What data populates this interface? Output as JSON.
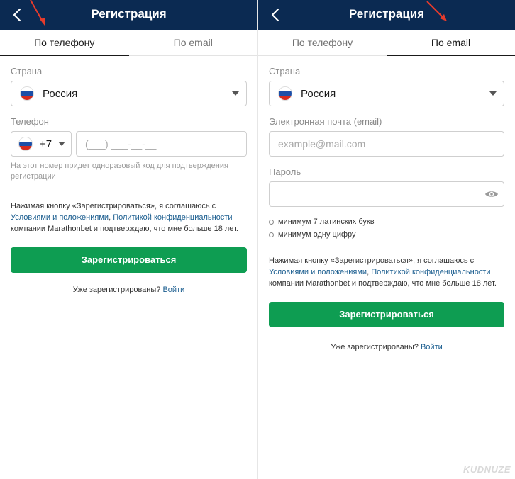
{
  "left": {
    "header": {
      "title": "Регистрация"
    },
    "tabs": [
      {
        "label": "По телефону",
        "active": true
      },
      {
        "label": "По email",
        "active": false
      }
    ],
    "country": {
      "label": "Страна",
      "value": "Россия"
    },
    "phone": {
      "label": "Телефон",
      "code": "+7",
      "placeholder": "(___) ___-__-__",
      "hint": "На этот номер придет одноразовый код для подтверждения регистрации"
    },
    "agreement": {
      "prefix": "Нажимая кнопку «Зарегистрироваться», я соглашаюсь с",
      "link1": "Условиями и положениями",
      "comma": ",",
      "link2": "Политикой конфиденциальности",
      "suffix": "компании Marathonbet и подтверждаю, что мне больше 18 лет."
    },
    "submit_label": "Зарегистрироваться",
    "login": {
      "question": "Уже зарегистрированы?",
      "link": "Войти"
    }
  },
  "right": {
    "header": {
      "title": "Регистрация"
    },
    "tabs": [
      {
        "label": "По телефону",
        "active": false
      },
      {
        "label": "По email",
        "active": true
      }
    ],
    "country": {
      "label": "Страна",
      "value": "Россия"
    },
    "email": {
      "label": "Электронная почта (email)",
      "placeholder": "example@mail.com"
    },
    "password": {
      "label": "Пароль",
      "rules": [
        "минимум 7 латинских букв",
        "минимум одну цифру"
      ]
    },
    "agreement": {
      "prefix": "Нажимая кнопку «Зарегистрироваться», я соглашаюсь с",
      "link1": "Условиями и положениями",
      "comma": ",",
      "link2": "Политикой конфиденциальности",
      "suffix": "компании Marathonbet и подтверждаю, что мне больше 18 лет."
    },
    "submit_label": "Зарегистрироваться",
    "login": {
      "question": "Уже зарегистрированы?",
      "link": "Войти"
    }
  },
  "icons": {
    "back": "chevron-left-icon",
    "flag": "russia-flag-icon",
    "dropdown": "triangle-down-icon",
    "eye": "eye-icon",
    "annotation": "red-arrow-icon"
  },
  "colors": {
    "header_bg": "#0b2a52",
    "primary_button": "#0e9d52",
    "link": "#1a5d8f",
    "annotation_arrow": "#e53b2c"
  },
  "watermark": "KUDNUZE"
}
